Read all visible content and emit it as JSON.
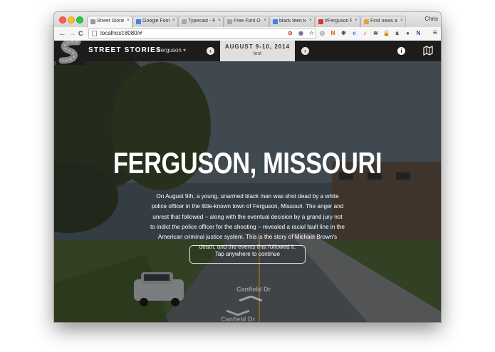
{
  "browser": {
    "tabs": [
      {
        "label": "Street Stories",
        "active": true,
        "favicon_color": "#9a9a9a"
      },
      {
        "label": "Google Fonts",
        "active": false,
        "favicon_color": "#4a7ee0"
      },
      {
        "label": "Typecast - Pi",
        "active": false,
        "favicon_color": "#a7a7a7"
      },
      {
        "label": "Free Font Ou",
        "active": false,
        "favicon_color": "#a7a7a7"
      },
      {
        "label": "black teen ki",
        "active": false,
        "favicon_color": "#4a7ee0"
      },
      {
        "label": "#Ferguson Fi",
        "active": false,
        "favicon_color": "#d33a2c"
      },
      {
        "label": "Find news an",
        "active": false,
        "favicon_color": "#e8a33a"
      }
    ],
    "tab_close_glyph": "×",
    "profile_name": "Chris",
    "back_glyph": "←",
    "forward_glyph": "→",
    "reload_glyph": "C",
    "url": "localhost:8080/#",
    "extensions": [
      {
        "name": "block-icon",
        "glyph": "⊘",
        "color": "#c0392b"
      },
      {
        "name": "color-icon",
        "glyph": "◉",
        "color": "#7b5ea7"
      },
      {
        "name": "star-icon",
        "glyph": "☆",
        "color": "#999999"
      },
      {
        "name": "camera-icon",
        "glyph": "◎",
        "color": "#8a8a8a"
      },
      {
        "name": "new-badge-icon",
        "glyph": "N",
        "color": "#d35400"
      },
      {
        "name": "gear-icon",
        "glyph": "✱",
        "color": "#555555"
      },
      {
        "name": "globe-icon",
        "glyph": "e",
        "color": "#2e86de"
      },
      {
        "name": "music-icon",
        "glyph": "♪",
        "color": "#8e44ad"
      },
      {
        "name": "layers-icon",
        "glyph": "≋",
        "color": "#333333"
      },
      {
        "name": "lock-icon",
        "glyph": "🔒",
        "color": "#2980b9"
      },
      {
        "name": "amazon-icon",
        "glyph": "a",
        "color": "#222222"
      },
      {
        "name": "circle-icon",
        "glyph": "●",
        "color": "#555555"
      },
      {
        "name": "n-icon",
        "glyph": "N",
        "color": "#1e4a8c"
      }
    ],
    "menu_glyph": "≡"
  },
  "app": {
    "brand": "STREET STORIES",
    "location": "Ferguson",
    "location_caret": "▾",
    "prev_glyph": "‹",
    "next_glyph": "›",
    "date_title": "AUGUST 9-10, 2014",
    "date_subtitle": "test",
    "info_glyph": "i",
    "hero": {
      "title": "FERGUSON, MISSOURI",
      "body": "On August 9th, a young, unarmed black man was shot dead by a white police officer in the little-known town of Ferguson, Missouri. The anger and unrest that followed – along with the eventual decision by a grand jury not to indict the police officer for the shooting – revealed a racial fault line in the American criminal justice system. This is the story of Michael Brown's death, and the events that followed it.",
      "continue_label": "Tap anywhere to continue"
    },
    "street_labels": [
      "Canfield Dr",
      "Canfield Dr"
    ]
  }
}
